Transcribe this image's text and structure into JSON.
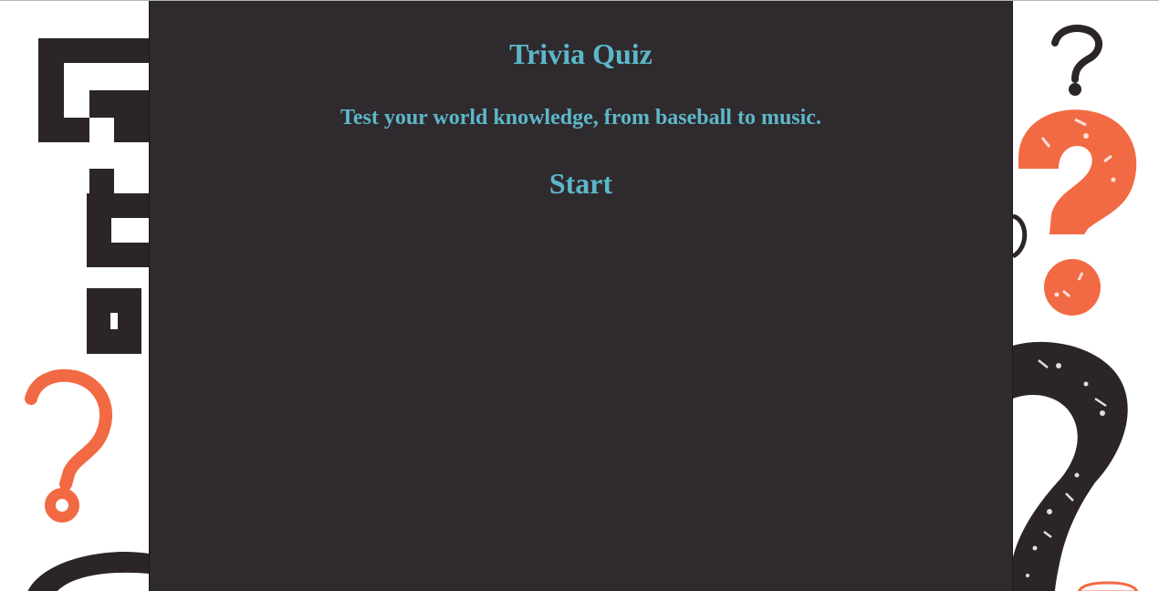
{
  "app": {
    "title": "Trivia Quiz",
    "subtitle": "Test your world knowledge, from baseball to music.",
    "start_label": "Start"
  },
  "colors": {
    "panel_background": "#2f2a2e",
    "accent_text": "#5cb8c9",
    "background_orange": "#f26a43",
    "background_dark": "#2b2527"
  },
  "icons": [
    "spiral-question-mark-icon",
    "orange-outline-question-mark-icon",
    "small-dark-question-mark-icon",
    "orange-textured-question-mark-icon",
    "dark-textured-question-mark-icon"
  ]
}
